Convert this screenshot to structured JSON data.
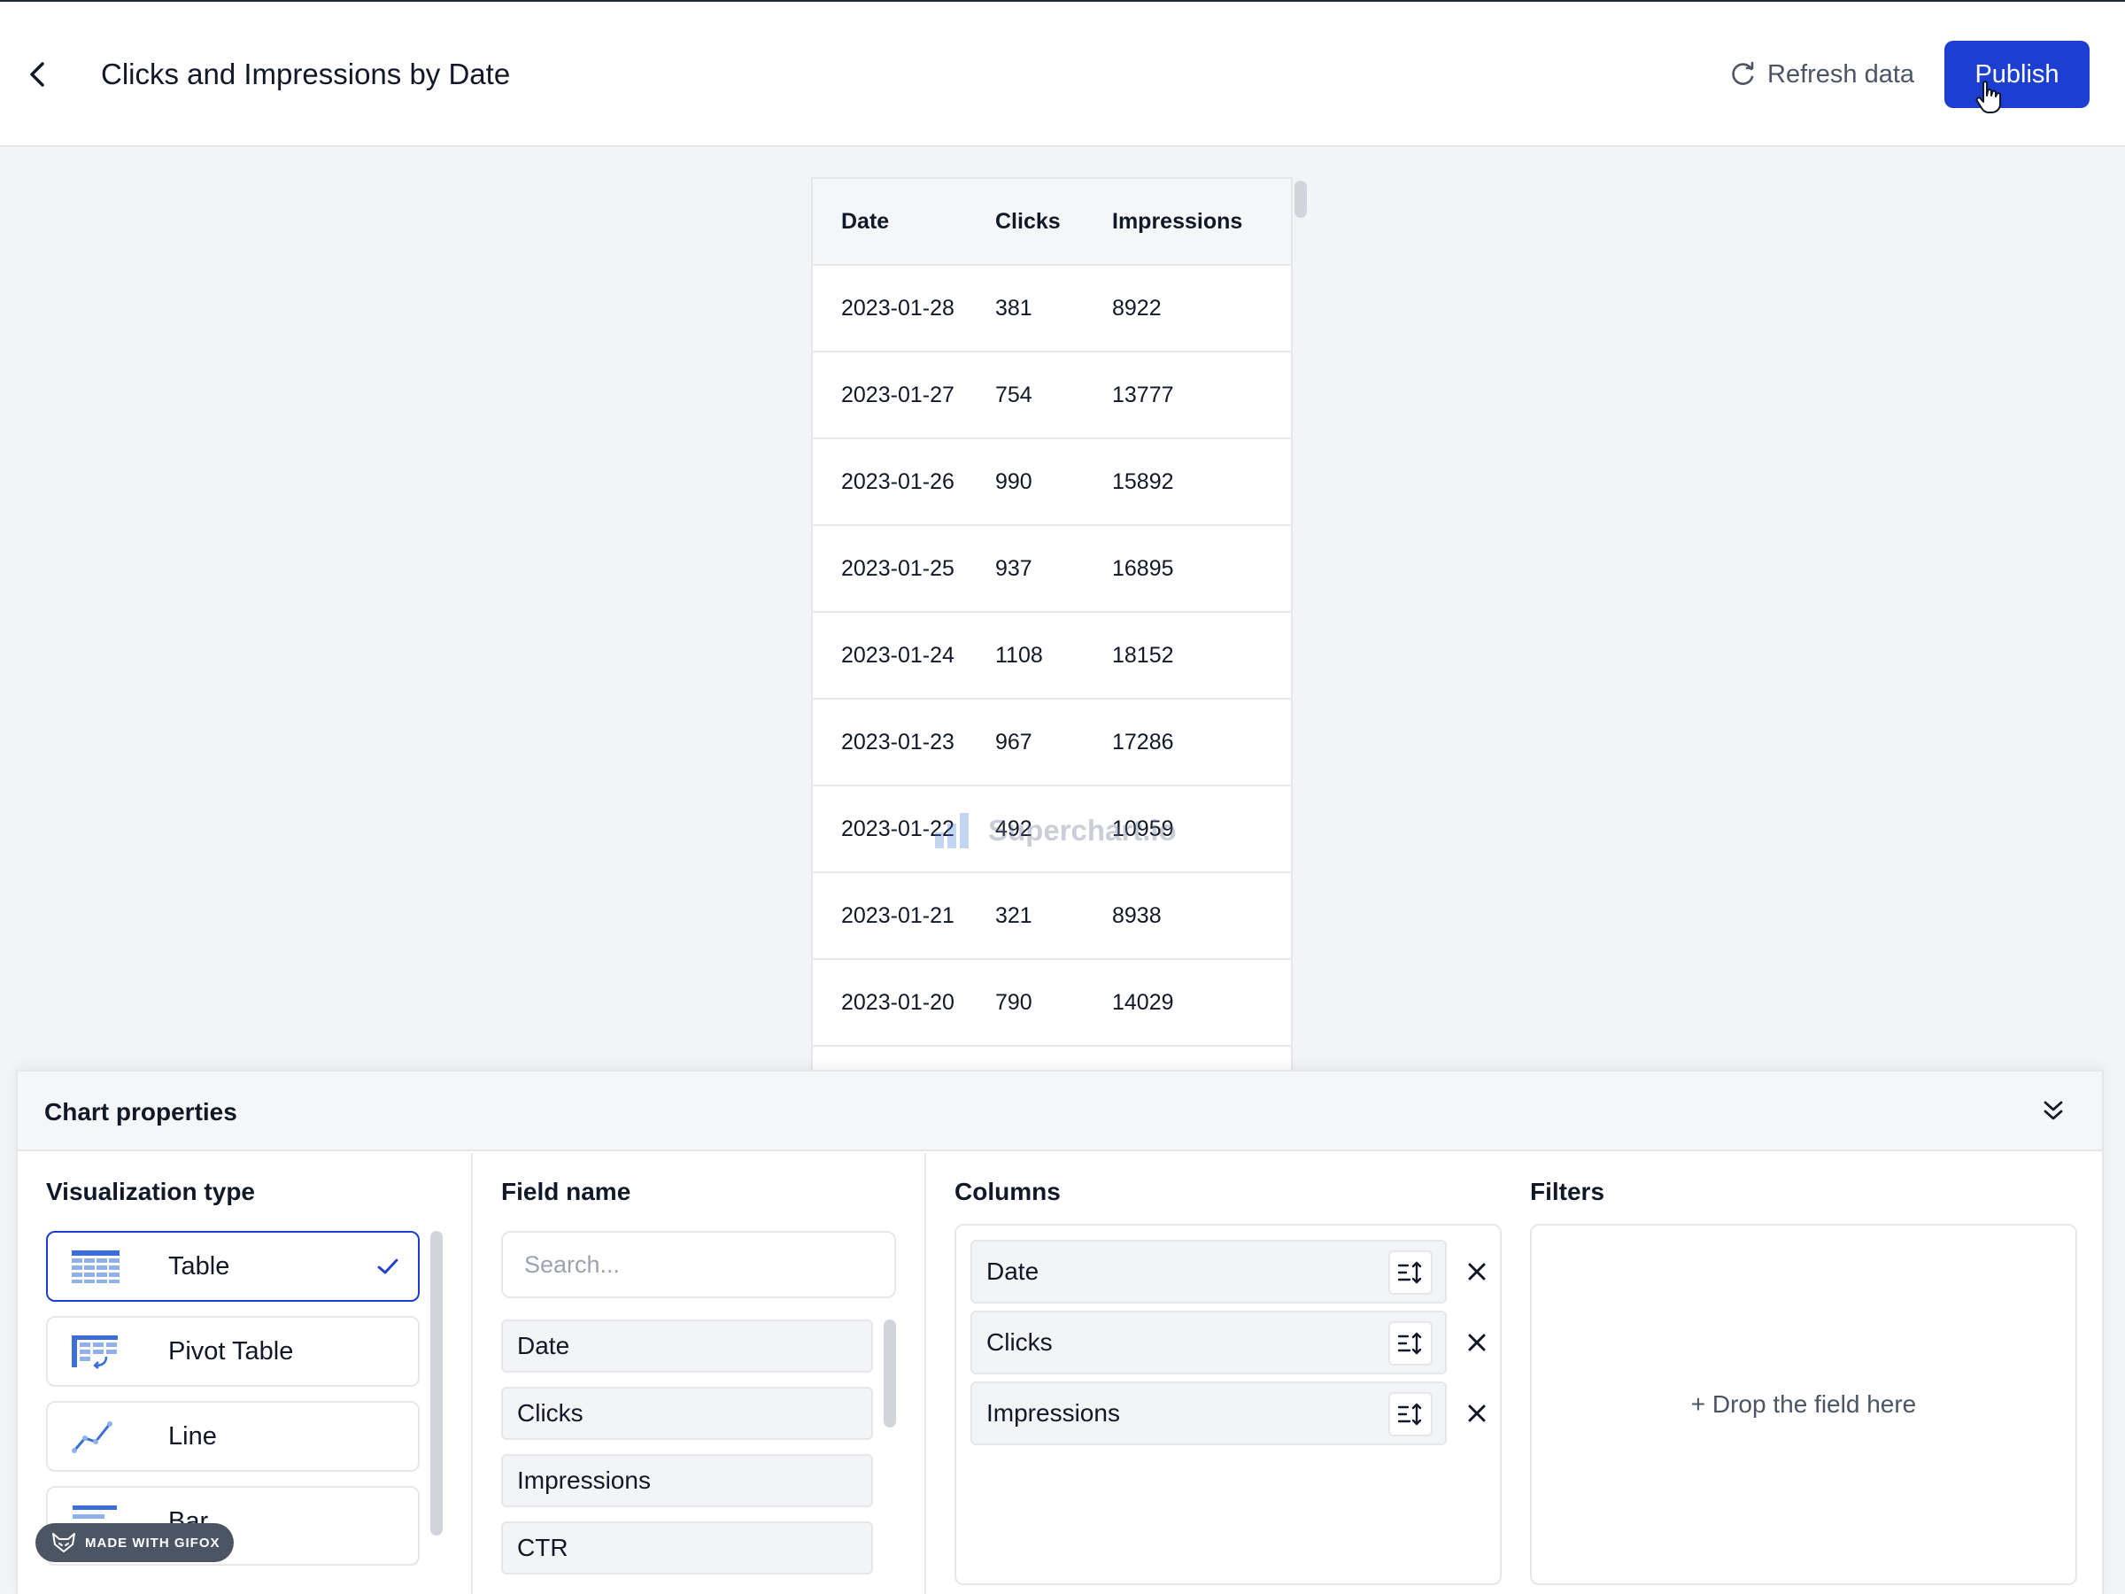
{
  "header": {
    "title": "Clicks and Impressions by Date",
    "refresh_label": "Refresh data",
    "publish_label": "Publish"
  },
  "table": {
    "columns": [
      "Date",
      "Clicks",
      "Impressions"
    ],
    "rows": [
      [
        "2023-01-28",
        "381",
        "8922"
      ],
      [
        "2023-01-27",
        "754",
        "13777"
      ],
      [
        "2023-01-26",
        "990",
        "15892"
      ],
      [
        "2023-01-25",
        "937",
        "16895"
      ],
      [
        "2023-01-24",
        "1108",
        "18152"
      ],
      [
        "2023-01-23",
        "967",
        "17286"
      ],
      [
        "2023-01-22",
        "492",
        "10959"
      ],
      [
        "2023-01-21",
        "321",
        "8938"
      ],
      [
        "2023-01-20",
        "790",
        "14029"
      ]
    ]
  },
  "watermark": "Superchart.io",
  "properties": {
    "title": "Chart properties",
    "viz": {
      "title": "Visualization type",
      "items": [
        {
          "label": "Table",
          "icon": "table-icon",
          "selected": true
        },
        {
          "label": "Pivot Table",
          "icon": "pivot-table-icon",
          "selected": false
        },
        {
          "label": "Line",
          "icon": "line-chart-icon",
          "selected": false
        },
        {
          "label": "Bar",
          "icon": "bar-chart-icon",
          "selected": false
        }
      ]
    },
    "fields": {
      "title": "Field name",
      "search_placeholder": "Search...",
      "items": [
        "Date",
        "Clicks",
        "Impressions",
        "CTR"
      ]
    },
    "columns": {
      "title": "Columns",
      "items": [
        "Date",
        "Clicks",
        "Impressions"
      ]
    },
    "filters": {
      "title": "Filters",
      "drop_hint": "+ Drop the field here"
    }
  },
  "gifox_badge": "MADE WITH GIFOX",
  "colors": {
    "accent": "#1d3fd1",
    "border": "#e5e7eb",
    "background": "#f3f4f6",
    "icon_blue": "#3b6fd6"
  }
}
